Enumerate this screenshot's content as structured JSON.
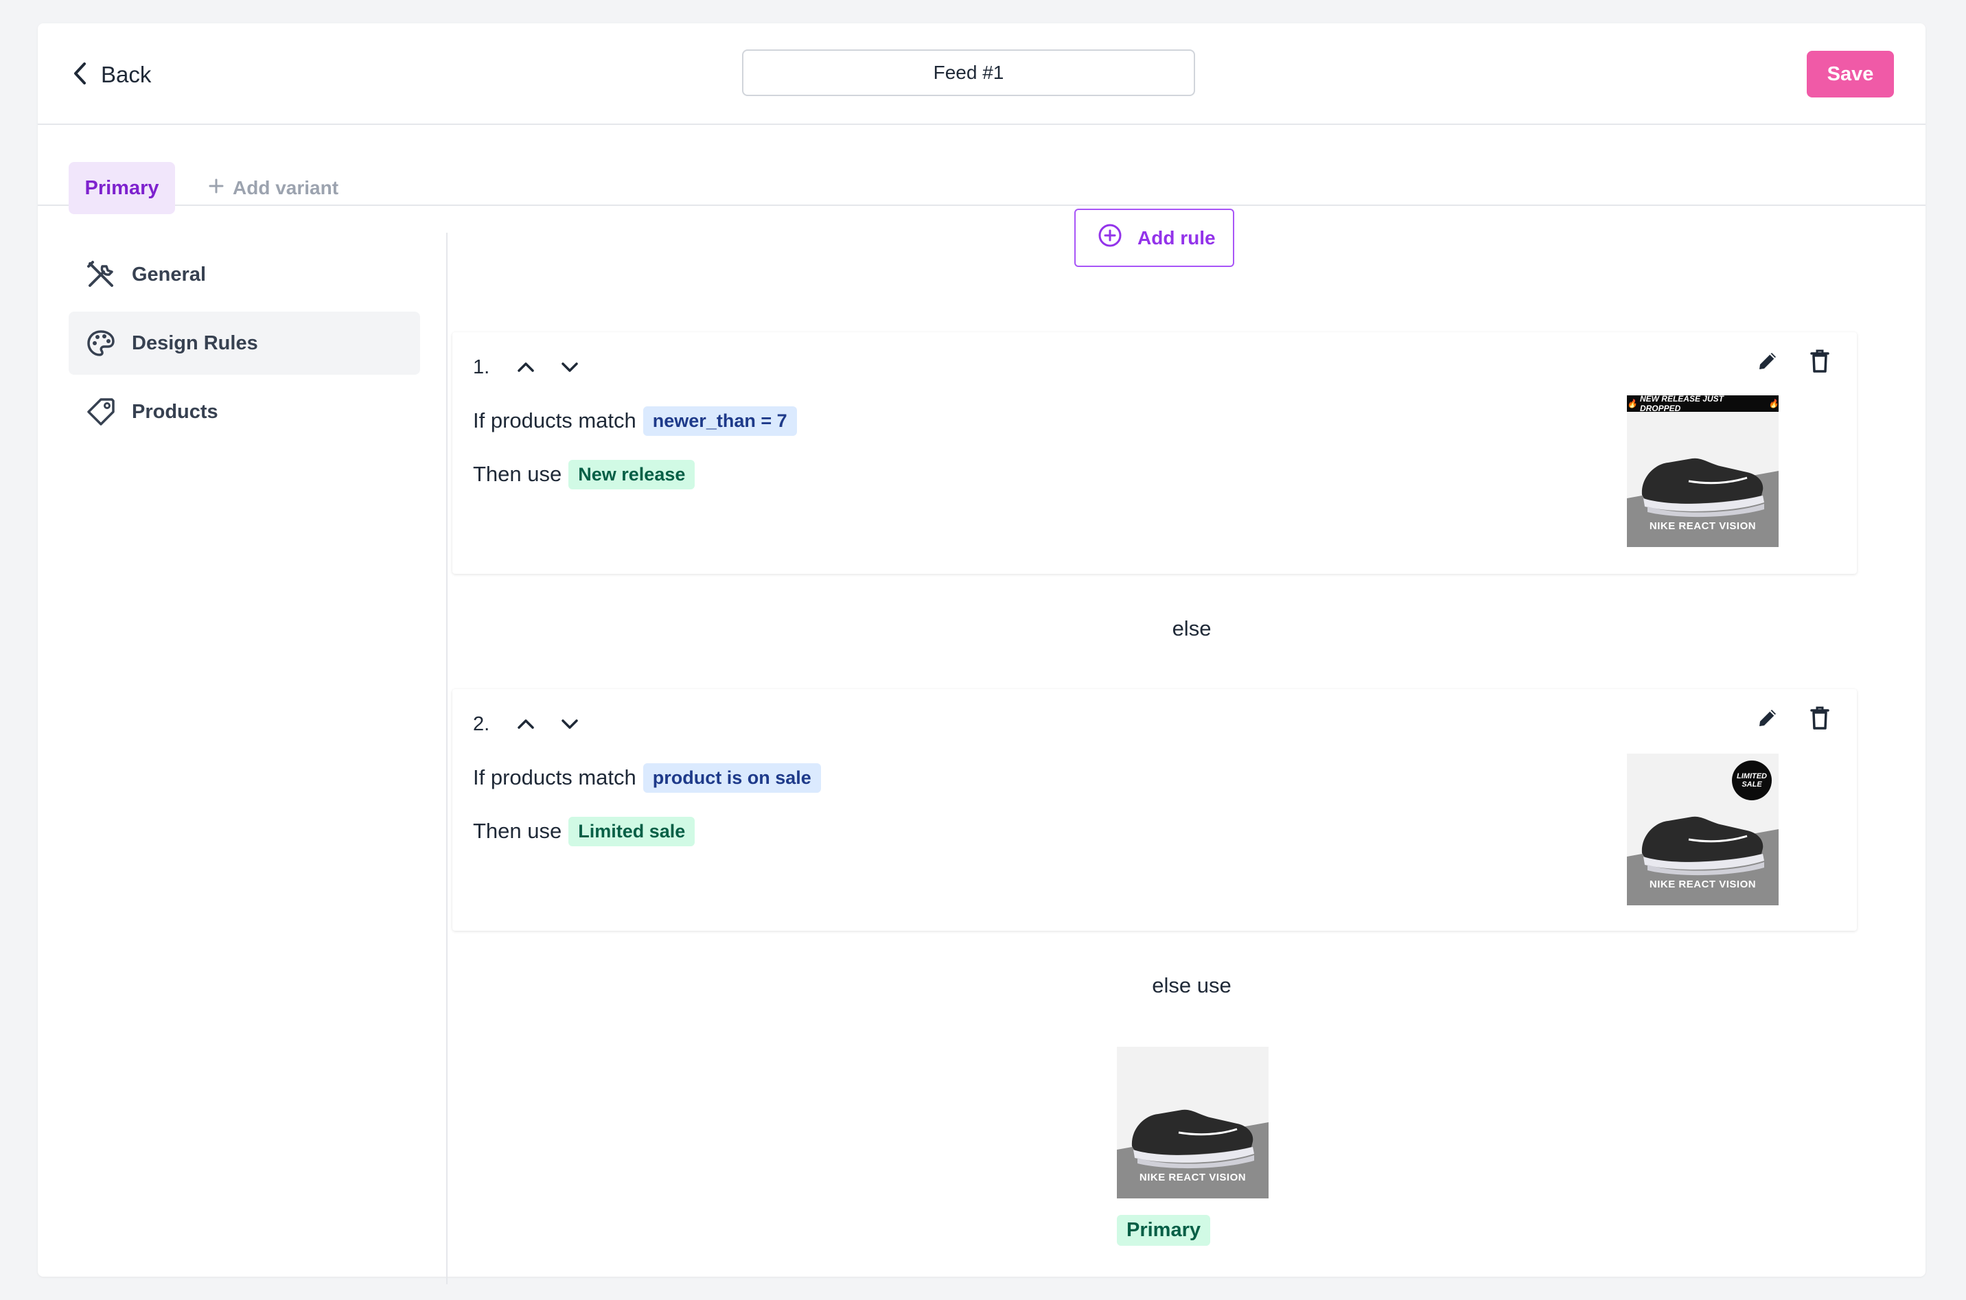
{
  "header": {
    "back_label": "Back",
    "feed_name": "Feed #1",
    "save_label": "Save"
  },
  "variants": {
    "primary_label": "Primary",
    "add_label": "Add variant"
  },
  "sidebar": {
    "items": [
      {
        "label": "General",
        "icon": "tools-icon",
        "active": false
      },
      {
        "label": "Design Rules",
        "icon": "palette-icon",
        "active": true
      },
      {
        "label": "Products",
        "icon": "tag-icon",
        "active": false
      }
    ]
  },
  "main": {
    "add_rule_label": "Add rule",
    "rules": [
      {
        "number": "1.",
        "if_label": "If products match",
        "condition": "newer_than = 7",
        "then_label": "Then use",
        "template": "New release",
        "thumb_banner": "NEW RELEASE JUST DROPPED",
        "thumb_caption": "NIKE REACT VISION"
      },
      {
        "number": "2.",
        "if_label": "If products match",
        "condition": "product is on sale",
        "then_label": "Then use",
        "template": "Limited sale",
        "thumb_badge": "LIMITED SALE",
        "thumb_caption": "NIKE REACT VISION"
      }
    ],
    "else_label": "else",
    "else_use_label": "else use",
    "default": {
      "thumb_caption": "NIKE REACT VISION",
      "template": "Primary"
    }
  },
  "colors": {
    "accent_purple": "#9333ea",
    "save_pink": "#f05aa7",
    "chip_blue_bg": "#dbeafe",
    "chip_green_bg": "#d1fae5"
  }
}
